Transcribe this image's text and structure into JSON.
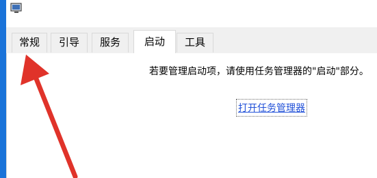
{
  "tabs": [
    {
      "label": "常规"
    },
    {
      "label": "引导"
    },
    {
      "label": "服务"
    },
    {
      "label": "启动"
    },
    {
      "label": "工具"
    }
  ],
  "startup": {
    "description": "若要管理启动项，请使用任务管理器的\"启动\"部分。",
    "open_task_manager": "打开任务管理器"
  },
  "colors": {
    "accent": "#1a73d9",
    "annotation_arrow": "#e0332a",
    "link": "#1f4fd8"
  },
  "icons": {
    "app": "system-config-icon"
  }
}
